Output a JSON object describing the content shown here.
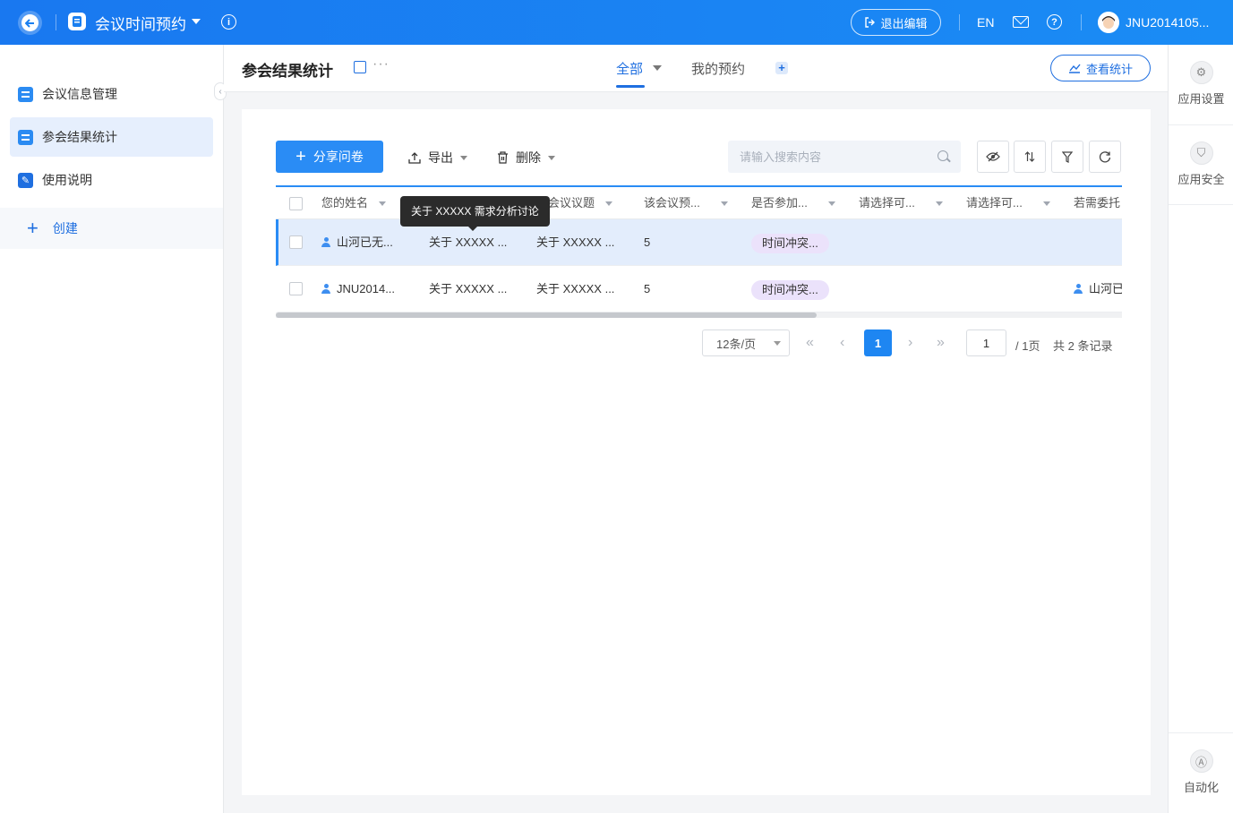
{
  "topbar": {
    "app_title": "会议时间预约",
    "exit_edit": "退出编辑",
    "lang": "EN",
    "user_name": "JNU2014105..."
  },
  "sidebar": {
    "items": [
      {
        "label": "会议信息管理",
        "icon": "doc-icon"
      },
      {
        "label": "参会结果统计",
        "icon": "doc-icon",
        "active": true
      },
      {
        "label": "使用说明",
        "icon": "edit-icon"
      }
    ],
    "create_label": "创建"
  },
  "header": {
    "page_title": "参会结果统计",
    "tabs": [
      {
        "label": "全部",
        "active": true
      },
      {
        "label": "我的预约"
      }
    ],
    "view_stats": "查看统计"
  },
  "rightrail": {
    "items": [
      "应用设置",
      "应用安全",
      "自动化"
    ]
  },
  "toolbar": {
    "share_label": "分享问卷",
    "export_label": "导出",
    "delete_label": "删除",
    "search_placeholder": "请输入搜索内容"
  },
  "table": {
    "columns": [
      "您的姓名",
      "关于 XXXXX 需求分析讨论",
      "该会议议题",
      "该会议预...",
      "是否参加...",
      "请选择可...",
      "请选择可...",
      "若需委托"
    ],
    "rows": [
      {
        "name": "山河已无...",
        "col2": "关于 XXXXX ...",
        "col3": "关于 XXXXX ...",
        "col4": "5",
        "tag": "时间冲突...",
        "col8": ""
      },
      {
        "name": "JNU2014...",
        "col2": "关于 XXXXX ...",
        "col3": "关于 XXXXX ...",
        "col4": "5",
        "tag": "时间冲突...",
        "col8": "山河已"
      }
    ],
    "tooltip": "关于 XXXXX 需求分析讨论"
  },
  "pagination": {
    "page_size": "12条/页",
    "current": "1",
    "jump_value": "1",
    "total_pages": "/ 1页",
    "total_records": "共 2 条记录"
  },
  "colors": {
    "primary": "#1f6fe0",
    "topbar": "#1a82f2",
    "tag_bg": "#ebe2fb",
    "selected_row": "#e3edfc"
  }
}
